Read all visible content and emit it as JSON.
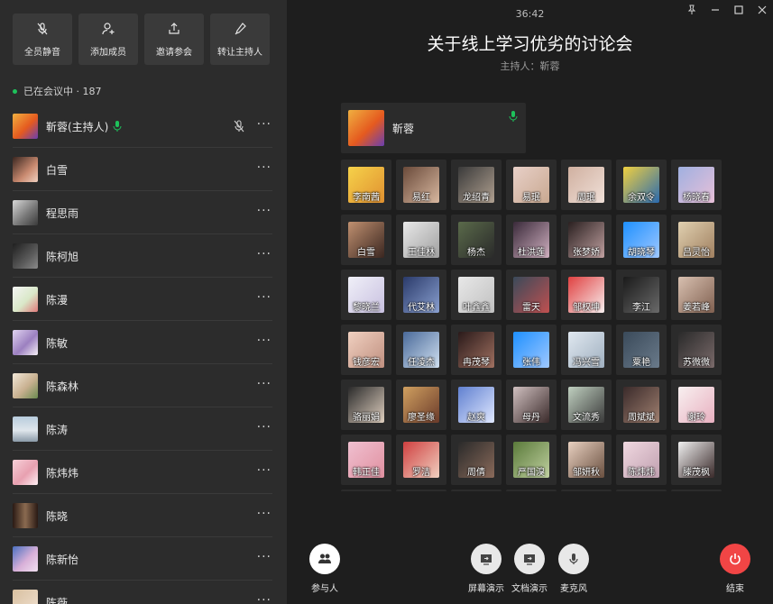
{
  "sidebar": {
    "buttons": [
      {
        "label": "全员静音",
        "icon": "mic-off-icon"
      },
      {
        "label": "添加成员",
        "icon": "add-user-icon"
      },
      {
        "label": "邀请参会",
        "icon": "share-icon"
      },
      {
        "label": "转让主持人",
        "icon": "pen-icon"
      }
    ],
    "status": "已在会议中 · 187",
    "participants": [
      {
        "name": "靳蓉(主持人)",
        "host": true
      },
      {
        "name": "白雪"
      },
      {
        "name": "程思雨"
      },
      {
        "name": "陈柯旭"
      },
      {
        "name": "陈漫"
      },
      {
        "name": "陈敏"
      },
      {
        "name": "陈森林"
      },
      {
        "name": "陈涛"
      },
      {
        "name": "陈炜炜"
      },
      {
        "name": "陈晓"
      },
      {
        "name": "陈新怡"
      },
      {
        "name": "陈薇"
      }
    ],
    "more_label": "···"
  },
  "meeting": {
    "timer": "36:42",
    "title": "关于线上学习优劣的讨论会",
    "host_line": "主持人：靳蓉",
    "host_card_name": "靳蓉"
  },
  "grid": [
    "李南茜",
    "易红",
    "龙绍青",
    "易珉",
    "周珉",
    "余双令",
    "杨晓春",
    "白雪",
    "王佳林",
    "杨杰",
    "杜洪莲",
    "张梦娇",
    "胡晓琴",
    "吕灵怡",
    "黎晓兰",
    "代艾林",
    "叶鑫鑫",
    "雷天",
    "邹权坤",
    "李江",
    "姜若峰",
    "钱彦宏",
    "任凌杰",
    "冉茂琴",
    "张伟",
    "冯兴雪",
    "粟艳",
    "苏微微",
    "骆丽娟",
    "廖圣缘",
    "赵爽",
    "母丹",
    "文流秀",
    "周斌斌",
    "谢玲",
    "韩正佳",
    "罗洁",
    "周倩",
    "严国溴",
    "邹妍秋",
    "陈炜炜",
    "滕茂枫",
    "",
    "",
    "",
    "",
    "",
    "",
    ""
  ],
  "bottom": {
    "participants_label": "参与人",
    "screen_share_label": "屏幕演示",
    "doc_share_label": "文档演示",
    "mic_label": "麦克风",
    "end_label": "结束"
  },
  "colors": {
    "accent_green": "#1ec25b",
    "end_red": "#f14545"
  }
}
